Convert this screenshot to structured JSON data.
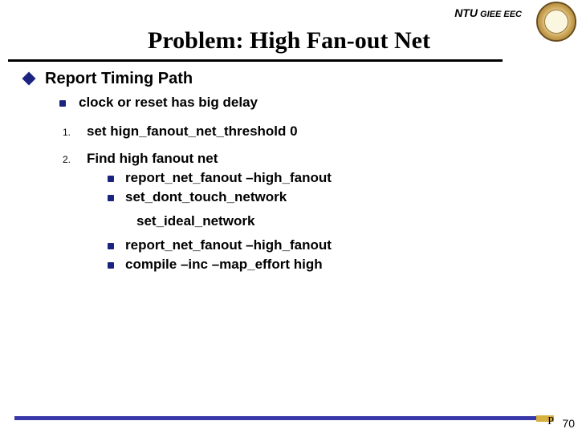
{
  "header": {
    "ntu": "NTU",
    "giee": " GIEE EEC"
  },
  "title": "Problem: High Fan-out Net",
  "lvl1": "Report Timing Path",
  "lvl2_a": "clock or reset has big delay",
  "num1": {
    "n": "1.",
    "text": "set hign_fanout_net_threshold 0"
  },
  "num2": {
    "n": "2.",
    "head": "Find high fanout net",
    "s1": "report_net_fanout  –high_fanout",
    "s2": "set_dont_touch_network",
    "mid": "set_ideal_network",
    "s3": "report_net_fanout  –high_fanout",
    "s4": "compile –inc –map_effort high"
  },
  "page": {
    "p": "P",
    "n": "70"
  }
}
